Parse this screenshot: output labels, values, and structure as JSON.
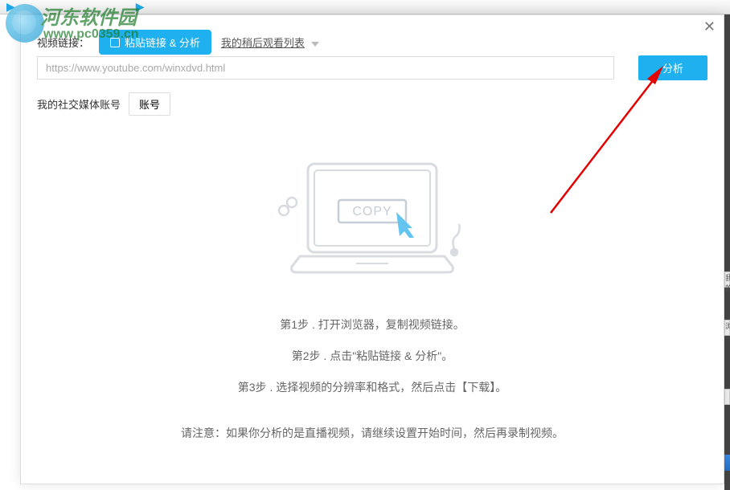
{
  "watermark": {
    "title": "河东软件园",
    "url": "www.pc0359.cn"
  },
  "modal": {
    "video_link_label": "视频链接：",
    "paste_analyze_btn": "粘贴链接 & 分析",
    "watch_later_link": "我的稍后观看列表",
    "url_value": "https://www.youtube.com/winxdvd.html",
    "analyze_btn": "分析",
    "social_account_label": "我的社交媒体账号",
    "account_btn": "账号",
    "copy_text": "COPY"
  },
  "steps": {
    "step1": "第1步 . 打开浏览器，复制视频链接。",
    "step2": "第2步 . 点击\"粘贴链接 & 分析\"。",
    "step3": "第3步 . 选择视频的分辨率和格式，然后点击【下载】。"
  },
  "notice": "请注意：如果你分析的是直播视频，请继续设置开始时间，然后再录制视频。",
  "right_labels": {
    "l1": "我的",
    "l2": "浏"
  }
}
